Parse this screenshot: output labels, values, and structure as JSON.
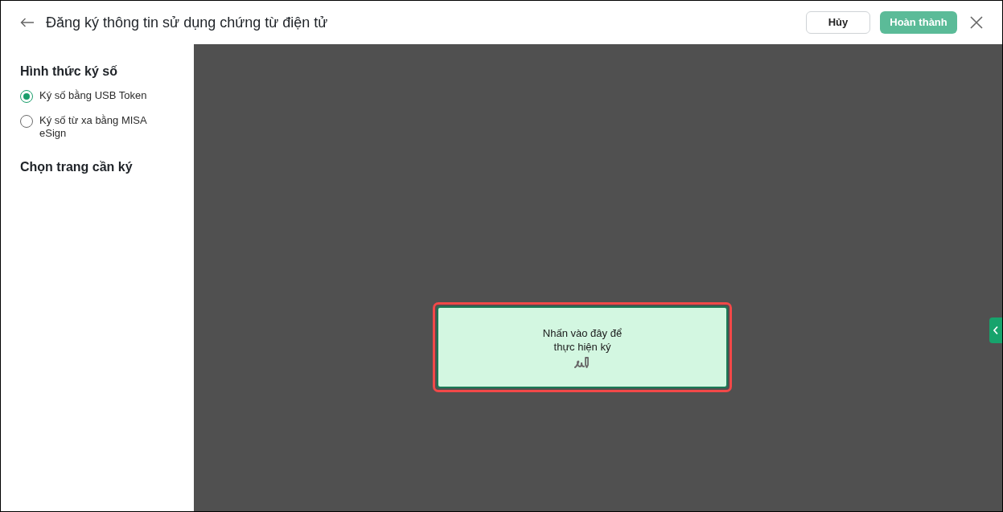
{
  "header": {
    "title": "Đăng ký thông tin sử dụng chứng từ điện tử",
    "buttons": [
      {
        "label": "Hủy",
        "kind": "outline"
      },
      {
        "label": "Hoàn thành",
        "kind": "primary"
      }
    ]
  },
  "sidebar": {
    "sections": [
      {
        "heading": "Hình thức ký số",
        "options": [
          {
            "label": "Ký số bằng USB Token",
            "selected": true
          },
          {
            "label": "Ký số từ xa bằng MISA eSign",
            "selected": false
          }
        ]
      },
      {
        "heading": "Chọn trang cần ký"
      }
    ]
  },
  "viewer": {
    "signature_box": {
      "text": "Nhấn vào đây để thực hiện ký",
      "selected": true
    }
  }
}
